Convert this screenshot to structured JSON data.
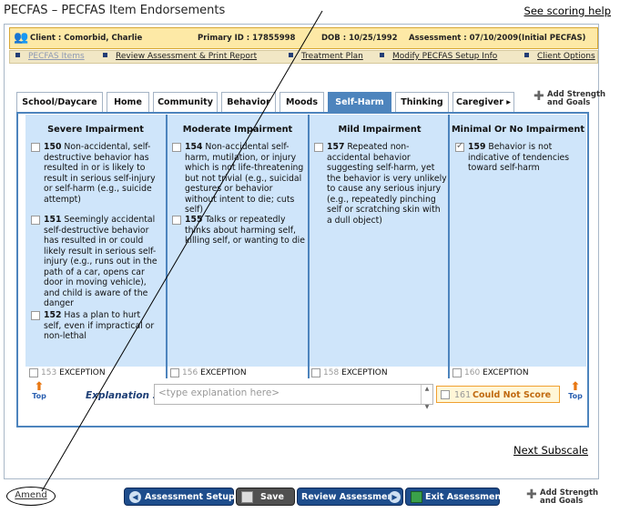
{
  "header": {
    "title": "PECFAS – PECFAS Item Endorsements",
    "help_link": "See scoring help"
  },
  "client": {
    "name": "Client : Comorbid, Charlie",
    "primary_id": "Primary ID : 17855998",
    "dob": "DOB : 10/25/1992",
    "assessment": "Assessment : 07/10/2009(Initial PECFAS)"
  },
  "nav": {
    "items": [
      "PECFAS Items",
      "Review Assessment & Print Report",
      "Treatment Plan",
      "Modify PECFAS Setup Info",
      "Client Options"
    ]
  },
  "tabs": [
    {
      "label": "School/Daycare"
    },
    {
      "label": "Home"
    },
    {
      "label": "Community"
    },
    {
      "label": "Behavior"
    },
    {
      "label": "Moods"
    },
    {
      "label": "Self-Harm"
    },
    {
      "label": "Thinking"
    },
    {
      "label": "Caregiver ▸"
    }
  ],
  "add_strength": {
    "line1": "Add Strength",
    "line2": "and Goals"
  },
  "columns": [
    {
      "heading": "Severe Impairment",
      "items": [
        {
          "num": "150",
          "text": "Non-accidental, self-destructive behavior has resulted in or is likely to result in serious self-injury or self-harm (e.g., suicide attempt)",
          "checked": false
        },
        {
          "num": "151",
          "text": "Seemingly accidental self-destructive behavior has resulted in or could likely result in serious self-injury (e.g., runs out in the path of a car, opens car door in moving vehicle), and child is aware of the danger",
          "checked": false
        },
        {
          "num": "152",
          "text": "Has a plan to hurt self, even if impractical or non-lethal",
          "checked": false
        }
      ],
      "exception": {
        "num": "153",
        "label": "EXCEPTION"
      }
    },
    {
      "heading": "Moderate Impairment",
      "items": [
        {
          "num": "154",
          "text": "Non-accidental self-harm, mutilation, or injury which is not life-threatening but not trivial (e.g., suicidal gestures or behavior without intent to die; cuts self)",
          "checked": false
        },
        {
          "num": "155",
          "text": "Talks or repeatedly thinks about harming self, killing self, or wanting to die",
          "checked": false
        }
      ],
      "exception": {
        "num": "156",
        "label": "EXCEPTION"
      }
    },
    {
      "heading": "Mild Impairment",
      "items": [
        {
          "num": "157",
          "text": "Repeated non-accidental behavior suggesting self-harm, yet the behavior is very unlikely to cause any serious injury (e.g., repeatedly pinching self or scratching skin with a dull object)",
          "checked": false
        }
      ],
      "exception": {
        "num": "158",
        "label": "EXCEPTION"
      }
    },
    {
      "heading": "Minimal Or No Impairment",
      "items": [
        {
          "num": "159",
          "text": "Behavior is not indicative of tendencies toward self-harm",
          "checked": true
        }
      ],
      "exception": {
        "num": "160",
        "label": "EXCEPTION"
      }
    }
  ],
  "top_label": "Top",
  "explanation": {
    "label": "Explanation :",
    "placeholder": "<type explanation here>"
  },
  "could_not_score": {
    "num": "161",
    "label": "Could Not Score"
  },
  "next_subscale": "Next Subscale",
  "amend": "Amend",
  "buttons": {
    "assessment_setup": "Assessment Setup",
    "save": "Save",
    "review": "Review Assessment",
    "exit": "Exit Assessment"
  },
  "colors": {
    "accent": "#4d84bd",
    "column_bg": "#cfe5fa",
    "client_bar": "#fde9a6",
    "button": "#1e4d8c"
  }
}
